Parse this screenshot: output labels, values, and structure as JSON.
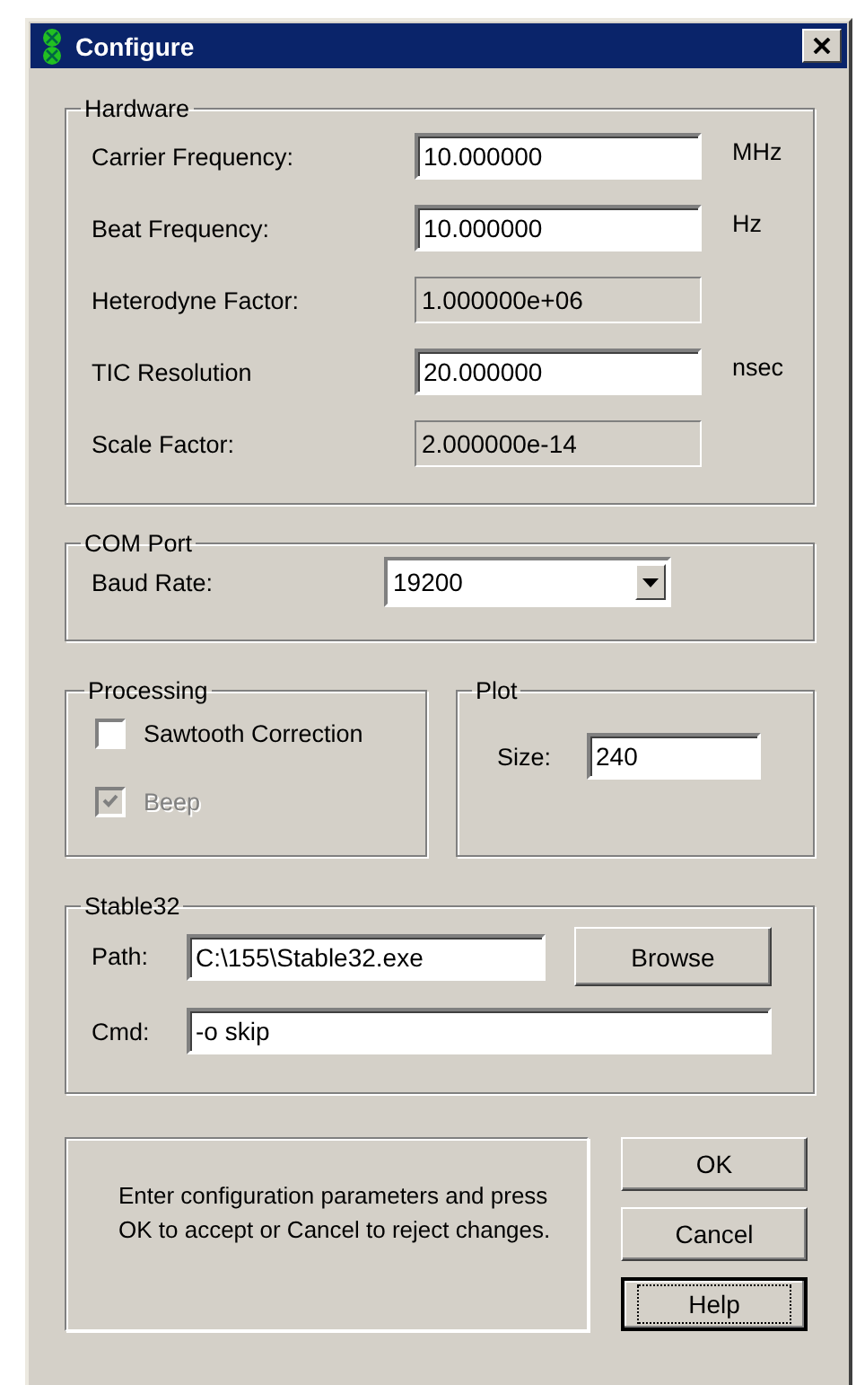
{
  "window": {
    "title": "Configure"
  },
  "hardware": {
    "title": "Hardware",
    "fields": [
      {
        "label": "Carrier Frequency:",
        "value": "10.000000",
        "unit": "MHz",
        "readonly": false
      },
      {
        "label": "Beat Frequency:",
        "value": "10.000000",
        "unit": "Hz",
        "readonly": false
      },
      {
        "label": "Heterodyne Factor:",
        "value": "1.000000e+06",
        "readonly": true
      },
      {
        "label": "TIC Resolution",
        "value": "20.000000",
        "unit": "nsec",
        "readonly": false
      },
      {
        "label": "Scale Factor:",
        "value": "2.000000e-14",
        "readonly": true
      }
    ]
  },
  "com_port": {
    "title": "COM Port",
    "label": "Baud Rate:",
    "value": "19200"
  },
  "processing": {
    "title": "Processing",
    "options": [
      {
        "label": "Sawtooth Correction",
        "checked": false,
        "disabled": false
      },
      {
        "label": "Beep",
        "checked": true,
        "disabled": true
      }
    ]
  },
  "plot": {
    "title": "Plot",
    "label": "Size:",
    "value": "240"
  },
  "stable32": {
    "title": "Stable32",
    "path_label": "Path:",
    "path": "C:\\155\\Stable32.exe",
    "browse": "Browse",
    "cmd_label": "Cmd:",
    "cmd": "-o skip"
  },
  "message": "Enter configuration parameters and press OK to accept or Cancel to reject changes.",
  "buttons": [
    {
      "label": "OK",
      "focused": false
    },
    {
      "label": "Cancel",
      "focused": false
    },
    {
      "label": "Help",
      "focused": true
    }
  ]
}
